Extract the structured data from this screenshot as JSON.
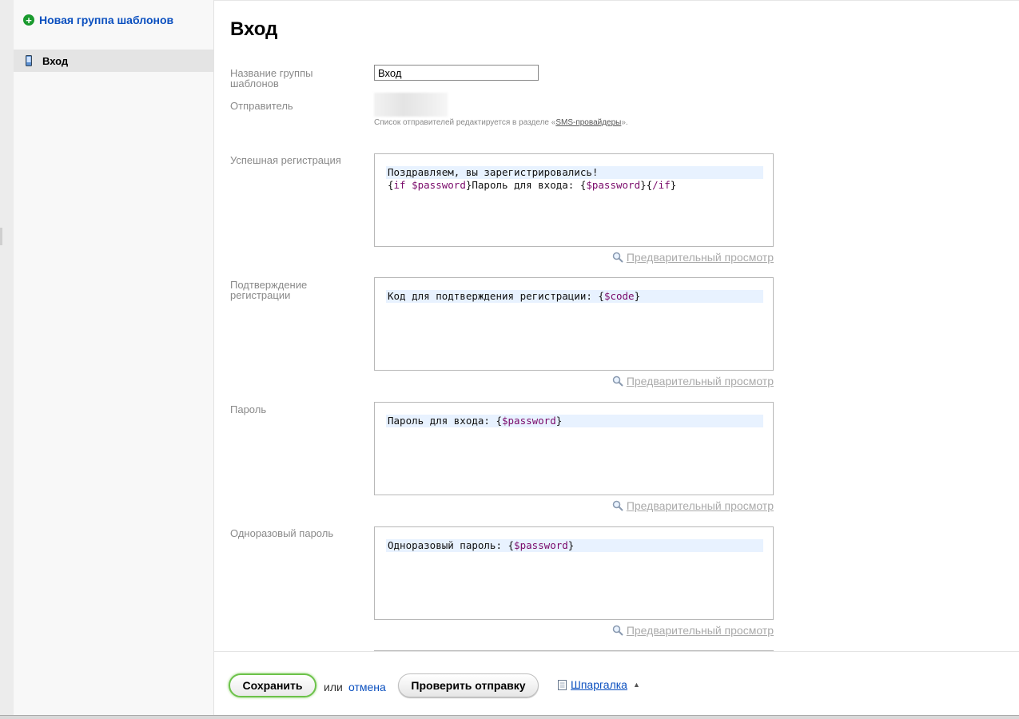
{
  "sidebar": {
    "new_group_label": "Новая группа шаблонов",
    "items": [
      {
        "label": "Вход",
        "icon": "phone-icon",
        "active": true
      }
    ]
  },
  "main": {
    "title": "Вход",
    "group_name": {
      "label": "Название группы шаблонов",
      "value": "Вход"
    },
    "sender": {
      "label": "Отправитель",
      "hint_prefix": "Список отправителей редактируется в разделе «",
      "hint_link": "SMS-провайдеры",
      "hint_suffix": "»."
    },
    "templates": [
      {
        "label": "Успешная регистрация",
        "lines": [
          [
            {
              "t": "Поздравляем, вы зарегистрировались!",
              "tok": false
            }
          ],
          [
            {
              "t": "{",
              "tok": false
            },
            {
              "t": "if $password",
              "tok": true
            },
            {
              "t": "}Пароль для входа: {",
              "tok": false
            },
            {
              "t": "$password",
              "tok": true
            },
            {
              "t": "}{",
              "tok": false
            },
            {
              "t": "/if",
              "tok": true
            },
            {
              "t": "}",
              "tok": false
            }
          ]
        ],
        "preview_label": "Предварительный просмотр"
      },
      {
        "label": "Подтверждение регистрации",
        "lines": [
          [
            {
              "t": "Код для подтверждения регистрации: {",
              "tok": false
            },
            {
              "t": "$code",
              "tok": true
            },
            {
              "t": "}",
              "tok": false
            }
          ]
        ],
        "preview_label": "Предварительный просмотр"
      },
      {
        "label": "Пароль",
        "lines": [
          [
            {
              "t": "Пароль для входа: {",
              "tok": false
            },
            {
              "t": "$password",
              "tok": true
            },
            {
              "t": "}",
              "tok": false
            }
          ]
        ],
        "preview_label": "Предварительный просмотр"
      },
      {
        "label": "Одноразовый пароль",
        "lines": [
          [
            {
              "t": "Одноразовый пароль: {",
              "tok": false
            },
            {
              "t": "$password",
              "tok": true
            },
            {
              "t": "}",
              "tok": false
            }
          ]
        ],
        "preview_label": "Предварительный просмотр"
      }
    ]
  },
  "footer": {
    "save_label": "Сохранить",
    "or_label": "или",
    "cancel_label": "отмена",
    "check_label": "Проверить отправку",
    "cheatsheet_label": "Шпаргалка"
  },
  "colors": {
    "link": "#0a4fbf",
    "save_border": "#6cc24a",
    "token": "#7a0a6a",
    "line_highlight": "#e8f2ff"
  }
}
